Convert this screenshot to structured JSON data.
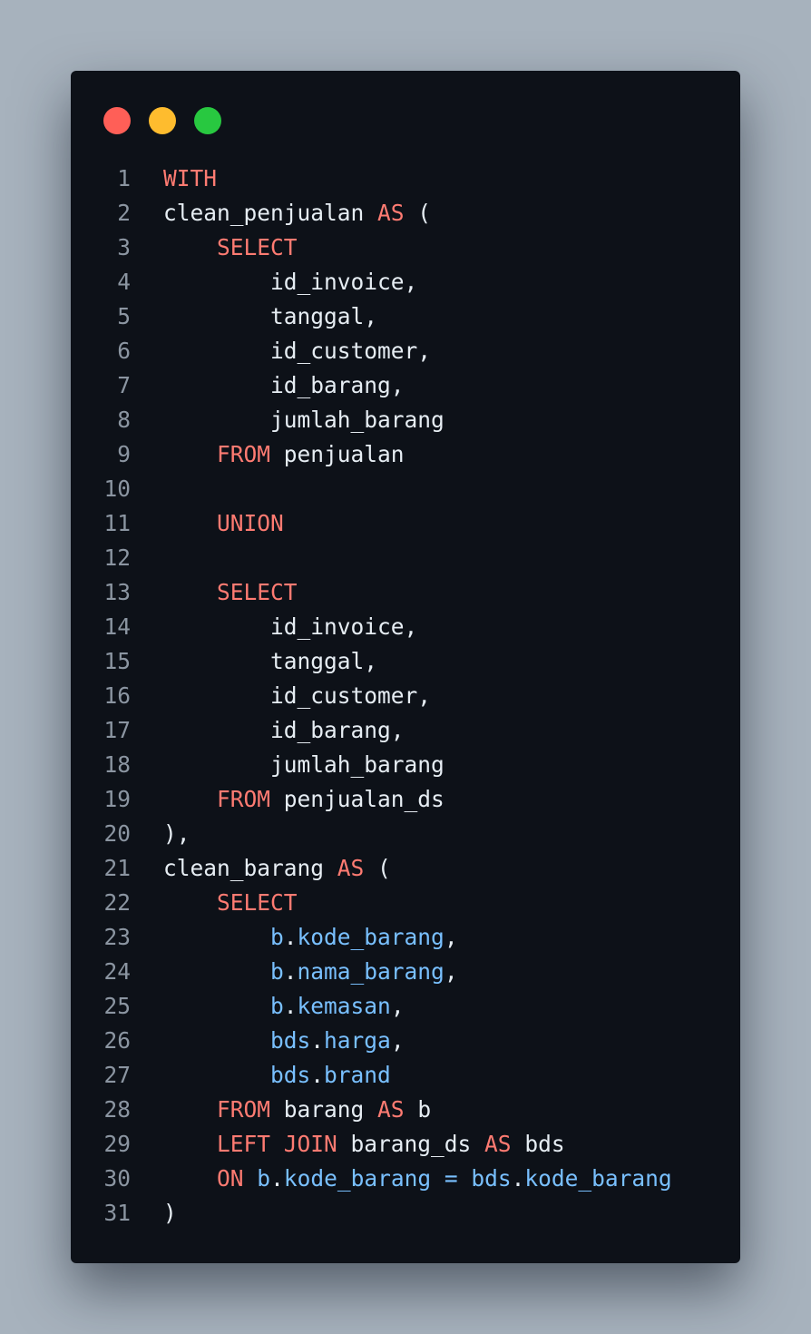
{
  "window": {
    "colors": {
      "background": "#0d1118",
      "close": "#ff5f57",
      "minimize": "#febc2e",
      "maximize": "#28c840",
      "keyword": "#ff7b72",
      "identifier": "#e6edf3",
      "member": "#79c0ff",
      "line_number": "#8b95a1"
    }
  },
  "code": {
    "language": "sql",
    "lines": [
      {
        "n": "1",
        "tokens": [
          {
            "t": "kw",
            "v": "WITH"
          }
        ]
      },
      {
        "n": "2",
        "tokens": [
          {
            "t": "id",
            "v": "clean_penjualan "
          },
          {
            "t": "kw",
            "v": "AS"
          },
          {
            "t": "pn",
            "v": " ("
          }
        ]
      },
      {
        "n": "3",
        "tokens": [
          {
            "t": "ws",
            "v": "    "
          },
          {
            "t": "kw",
            "v": "SELECT"
          }
        ]
      },
      {
        "n": "4",
        "tokens": [
          {
            "t": "ws",
            "v": "        "
          },
          {
            "t": "id",
            "v": "id_invoice,"
          }
        ]
      },
      {
        "n": "5",
        "tokens": [
          {
            "t": "ws",
            "v": "        "
          },
          {
            "t": "id",
            "v": "tanggal,"
          }
        ]
      },
      {
        "n": "6",
        "tokens": [
          {
            "t": "ws",
            "v": "        "
          },
          {
            "t": "id",
            "v": "id_customer,"
          }
        ]
      },
      {
        "n": "7",
        "tokens": [
          {
            "t": "ws",
            "v": "        "
          },
          {
            "t": "id",
            "v": "id_barang,"
          }
        ]
      },
      {
        "n": "8",
        "tokens": [
          {
            "t": "ws",
            "v": "        "
          },
          {
            "t": "id",
            "v": "jumlah_barang"
          }
        ]
      },
      {
        "n": "9",
        "tokens": [
          {
            "t": "ws",
            "v": "    "
          },
          {
            "t": "kw",
            "v": "FROM"
          },
          {
            "t": "id",
            "v": " penjualan"
          }
        ]
      },
      {
        "n": "10",
        "tokens": []
      },
      {
        "n": "11",
        "tokens": [
          {
            "t": "ws",
            "v": "    "
          },
          {
            "t": "kw",
            "v": "UNION"
          }
        ]
      },
      {
        "n": "12",
        "tokens": []
      },
      {
        "n": "13",
        "tokens": [
          {
            "t": "ws",
            "v": "    "
          },
          {
            "t": "kw",
            "v": "SELECT"
          }
        ]
      },
      {
        "n": "14",
        "tokens": [
          {
            "t": "ws",
            "v": "        "
          },
          {
            "t": "id",
            "v": "id_invoice,"
          }
        ]
      },
      {
        "n": "15",
        "tokens": [
          {
            "t": "ws",
            "v": "        "
          },
          {
            "t": "id",
            "v": "tanggal,"
          }
        ]
      },
      {
        "n": "16",
        "tokens": [
          {
            "t": "ws",
            "v": "        "
          },
          {
            "t": "id",
            "v": "id_customer,"
          }
        ]
      },
      {
        "n": "17",
        "tokens": [
          {
            "t": "ws",
            "v": "        "
          },
          {
            "t": "id",
            "v": "id_barang,"
          }
        ]
      },
      {
        "n": "18",
        "tokens": [
          {
            "t": "ws",
            "v": "        "
          },
          {
            "t": "id",
            "v": "jumlah_barang"
          }
        ]
      },
      {
        "n": "19",
        "tokens": [
          {
            "t": "ws",
            "v": "    "
          },
          {
            "t": "kw",
            "v": "FROM"
          },
          {
            "t": "id",
            "v": " penjualan_ds"
          }
        ]
      },
      {
        "n": "20",
        "tokens": [
          {
            "t": "pn",
            "v": "),"
          }
        ]
      },
      {
        "n": "21",
        "tokens": [
          {
            "t": "id",
            "v": "clean_barang "
          },
          {
            "t": "kw",
            "v": "AS"
          },
          {
            "t": "pn",
            "v": " ("
          }
        ]
      },
      {
        "n": "22",
        "tokens": [
          {
            "t": "ws",
            "v": "    "
          },
          {
            "t": "kw",
            "v": "SELECT"
          }
        ]
      },
      {
        "n": "23",
        "tokens": [
          {
            "t": "ws",
            "v": "        "
          },
          {
            "t": "mem",
            "v": "b"
          },
          {
            "t": "pn",
            "v": "."
          },
          {
            "t": "mem",
            "v": "kode_barang"
          },
          {
            "t": "pn",
            "v": ","
          }
        ]
      },
      {
        "n": "24",
        "tokens": [
          {
            "t": "ws",
            "v": "        "
          },
          {
            "t": "mem",
            "v": "b"
          },
          {
            "t": "pn",
            "v": "."
          },
          {
            "t": "mem",
            "v": "nama_barang"
          },
          {
            "t": "pn",
            "v": ","
          }
        ]
      },
      {
        "n": "25",
        "tokens": [
          {
            "t": "ws",
            "v": "        "
          },
          {
            "t": "mem",
            "v": "b"
          },
          {
            "t": "pn",
            "v": "."
          },
          {
            "t": "mem",
            "v": "kemasan"
          },
          {
            "t": "pn",
            "v": ","
          }
        ]
      },
      {
        "n": "26",
        "tokens": [
          {
            "t": "ws",
            "v": "        "
          },
          {
            "t": "mem",
            "v": "bds"
          },
          {
            "t": "pn",
            "v": "."
          },
          {
            "t": "mem",
            "v": "harga"
          },
          {
            "t": "pn",
            "v": ","
          }
        ]
      },
      {
        "n": "27",
        "tokens": [
          {
            "t": "ws",
            "v": "        "
          },
          {
            "t": "mem",
            "v": "bds"
          },
          {
            "t": "pn",
            "v": "."
          },
          {
            "t": "mem",
            "v": "brand"
          }
        ]
      },
      {
        "n": "28",
        "tokens": [
          {
            "t": "ws",
            "v": "    "
          },
          {
            "t": "kw",
            "v": "FROM"
          },
          {
            "t": "id",
            "v": " barang "
          },
          {
            "t": "kw",
            "v": "AS"
          },
          {
            "t": "id",
            "v": " b"
          }
        ]
      },
      {
        "n": "29",
        "tokens": [
          {
            "t": "ws",
            "v": "    "
          },
          {
            "t": "kw",
            "v": "LEFT JOIN"
          },
          {
            "t": "id",
            "v": " barang_ds "
          },
          {
            "t": "kw",
            "v": "AS"
          },
          {
            "t": "id",
            "v": " bds"
          }
        ]
      },
      {
        "n": "30",
        "tokens": [
          {
            "t": "ws",
            "v": "    "
          },
          {
            "t": "kw",
            "v": "ON"
          },
          {
            "t": "ws",
            "v": " "
          },
          {
            "t": "mem",
            "v": "b"
          },
          {
            "t": "pn",
            "v": "."
          },
          {
            "t": "mem",
            "v": "kode_barang"
          },
          {
            "t": "op",
            "v": " = "
          },
          {
            "t": "mem",
            "v": "bds"
          },
          {
            "t": "pn",
            "v": "."
          },
          {
            "t": "mem",
            "v": "kode_barang"
          }
        ]
      },
      {
        "n": "31",
        "tokens": [
          {
            "t": "pn",
            "v": ")"
          }
        ]
      }
    ]
  }
}
